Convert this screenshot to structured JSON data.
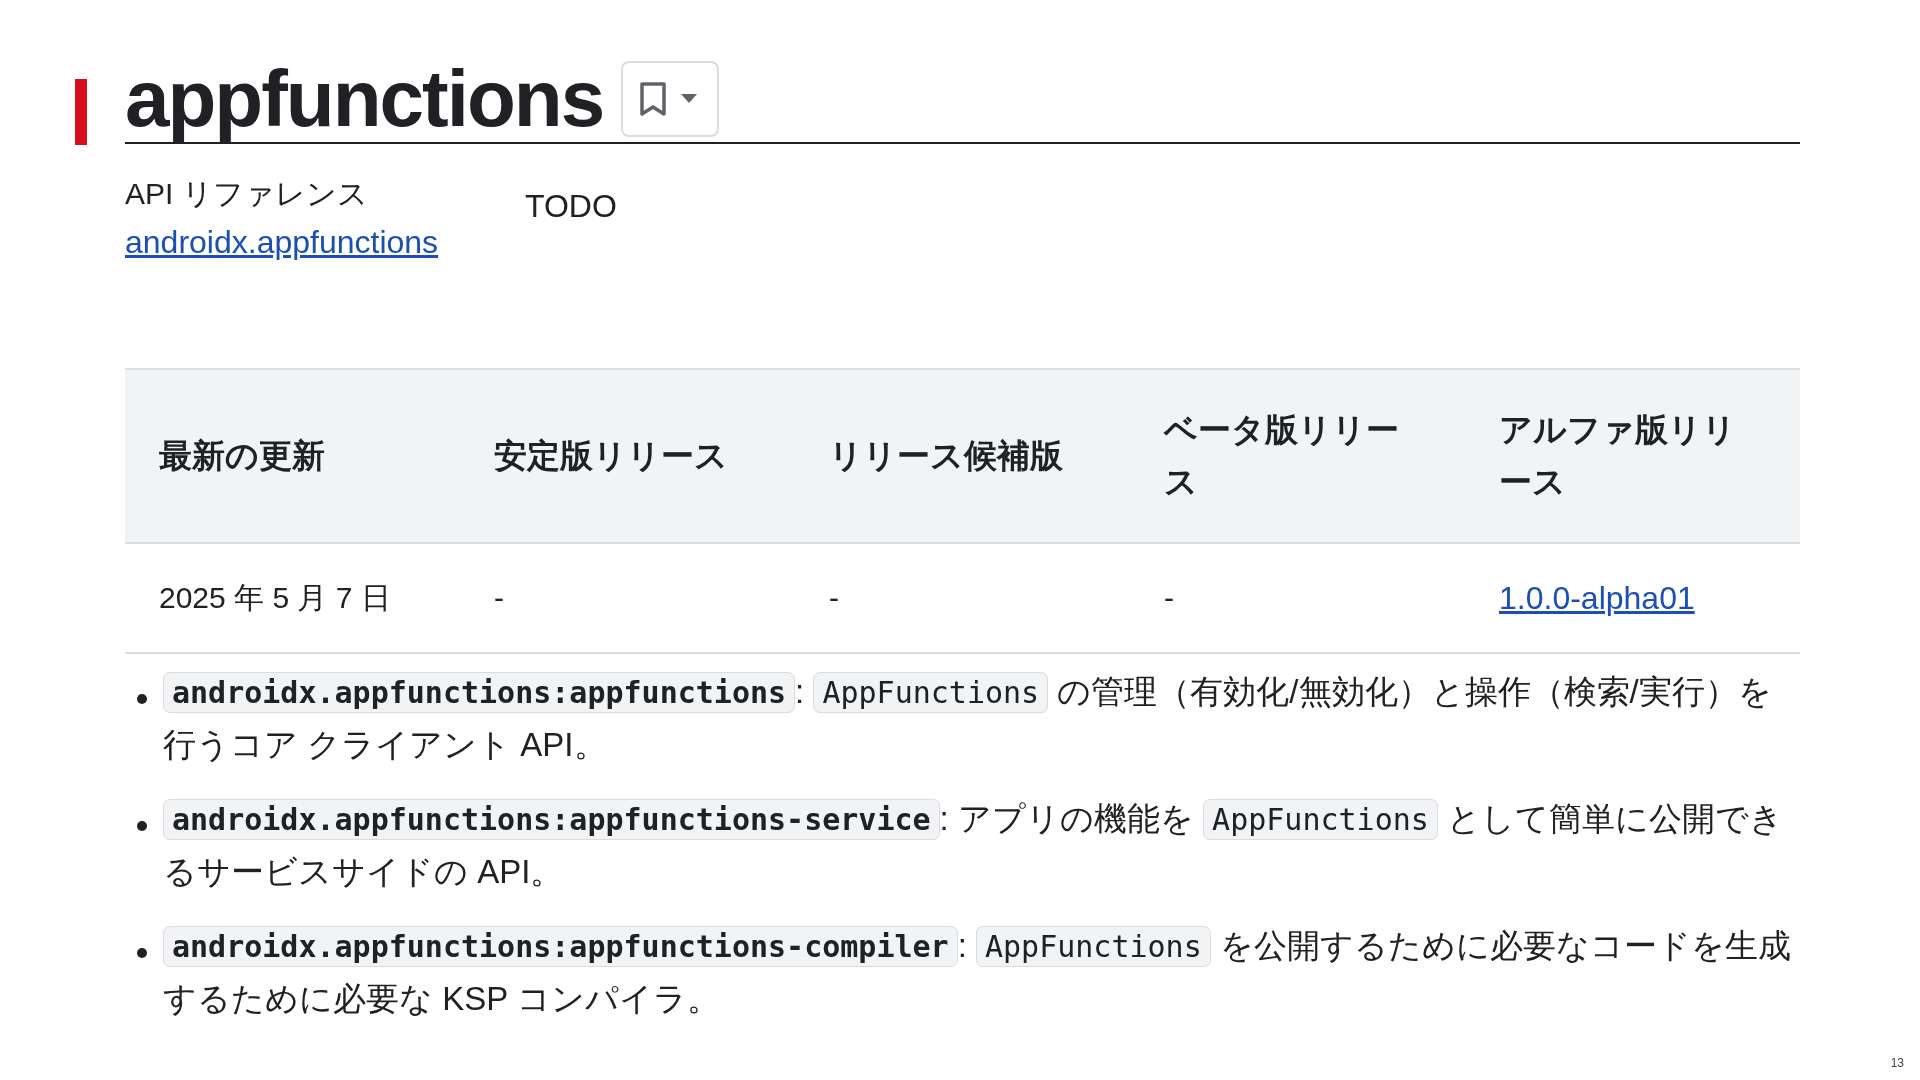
{
  "title": "appfunctions",
  "info": {
    "label": "API リファレンス",
    "link": "androidx.appfunctions",
    "note": "TODO"
  },
  "table": {
    "columns": [
      "最新の更新",
      "安定版リリース",
      "リリース候補版",
      "ベータ版リリース",
      "アルファ版リリース"
    ],
    "rows": [
      {
        "cells": [
          {
            "kind": "text",
            "text": "2025 年 5 月 7 日"
          },
          {
            "kind": "text",
            "text": "-"
          },
          {
            "kind": "text",
            "text": "-"
          },
          {
            "kind": "text",
            "text": "-"
          },
          {
            "kind": "link",
            "text": "1.0.0-alpha01"
          }
        ]
      }
    ]
  },
  "bullets": [
    {
      "parts": [
        {
          "kind": "code_bold",
          "text": "androidx.appfunctions:appfunctions"
        },
        {
          "kind": "text",
          "text": ": "
        },
        {
          "kind": "code",
          "text": "AppFunctions"
        },
        {
          "kind": "text",
          "text": " の管理（有効化/無効化）と操作（検索/実行）を行うコア クライアント API。"
        }
      ]
    },
    {
      "parts": [
        {
          "kind": "code_bold",
          "text": "androidx.appfunctions:appfunctions-service"
        },
        {
          "kind": "text",
          "text": ": アプリの機能を "
        },
        {
          "kind": "code",
          "text": "AppFunctions"
        },
        {
          "kind": "text",
          "text": " として簡単に公開できるサービスサイドの API。"
        }
      ]
    },
    {
      "parts": [
        {
          "kind": "code_bold",
          "text": "androidx.appfunctions:appfunctions-compiler"
        },
        {
          "kind": "text",
          "text": ": "
        },
        {
          "kind": "code",
          "text": "AppFunctions"
        },
        {
          "kind": "text",
          "text": " を公開するために必要なコードを生成するために必要な KSP コンパイラ。"
        }
      ]
    }
  ],
  "page_number": "13"
}
